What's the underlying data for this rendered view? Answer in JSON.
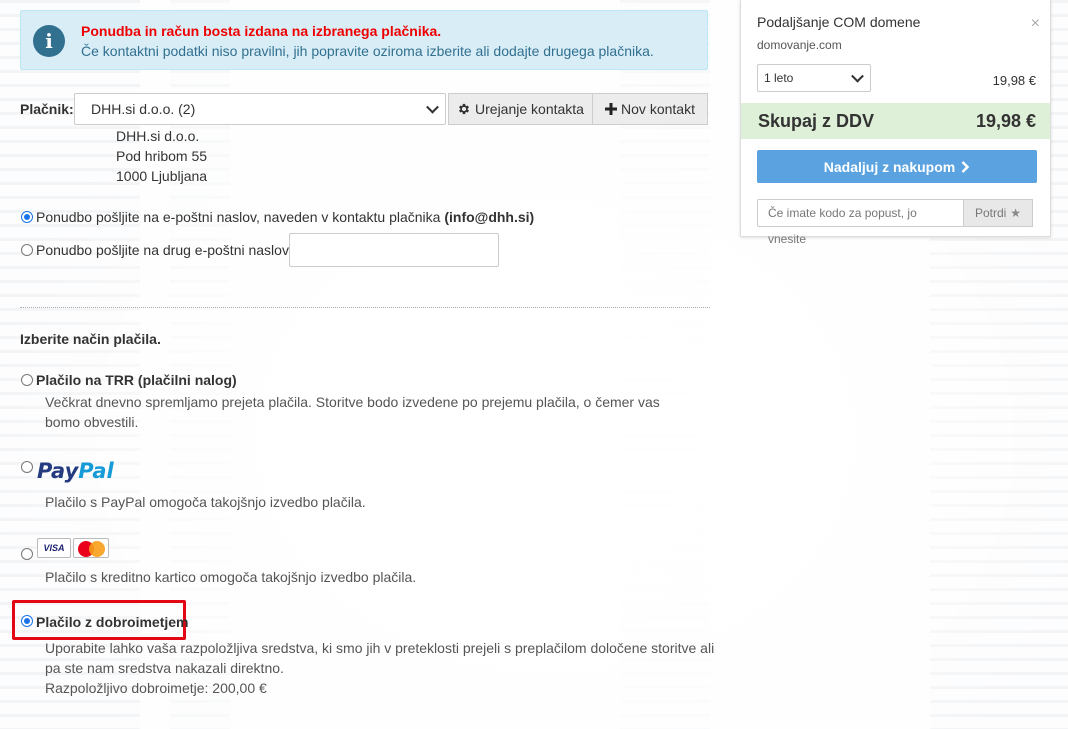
{
  "alert": {
    "title": "Ponudba in račun bosta izdana na izbranega plačnika.",
    "message": "Če kontaktni podatki niso pravilni, jih popravite oziroma izberite ali dodajte drugega plačnika.",
    "icon": "info-icon"
  },
  "payer": {
    "label": "Plačnik:",
    "selected": "DHH.si d.o.o. (2)",
    "edit_button": "Urejanje kontakta",
    "new_button": "Nov kontakt",
    "address": [
      "DHH.si d.o.o.",
      "Pod hribom 55",
      "1000 Ljubljana"
    ]
  },
  "email_options": {
    "option1_text": "Ponudbo pošljite na e-poštni naslov, naveden v kontaktu plačnika",
    "option1_email": "(info@dhh.si)",
    "option2_text": "Ponudbo pošljite na drug e-poštni naslov:",
    "option2_value": "",
    "selected": 1
  },
  "payment": {
    "heading": "Izberite način plačila.",
    "trr_label": "Plačilo na TRR (plačilni nalog)",
    "trr_desc": "Večkrat dnevno spremljamo prejeta plačila. Storitve bodo izvedene po prejemu plačila, o čemer vas bomo obvestili.",
    "paypal_logo_1": "Pay",
    "paypal_logo_2": "Pal",
    "paypal_desc": "Plačilo s PayPal omogoča takojšnjo izvedbo plačila.",
    "card_visa": "VISA",
    "card_desc": "Plačilo s kreditno kartico omogoča takojšnjo izvedbo plačila.",
    "credit_label": "Plačilo z dobroimetjem",
    "credit_desc_1": "Uporabite lahko vaša razpoložljiva sredstva, ki smo jih v preteklosti prejeli s preplačilom določene storitve ali",
    "credit_desc_2": "pa ste nam sredstva nakazali direktno.",
    "credit_balance": "Razpoložljivo dobroimetje: 200,00 €",
    "selected": "credit"
  },
  "cart": {
    "item_name": "Podaljšanje COM domene",
    "item_domain": "domovanje.com",
    "period": "1 leto",
    "price": "19,98 €",
    "total_label": "Skupaj z DDV",
    "total_value": "19,98 €",
    "continue_button": "Nadaljuj z nakupom",
    "promo_placeholder": "Če imate kodo za popust, jo vnesite",
    "apply_button": "Potrdi",
    "close_symbol": "×"
  }
}
